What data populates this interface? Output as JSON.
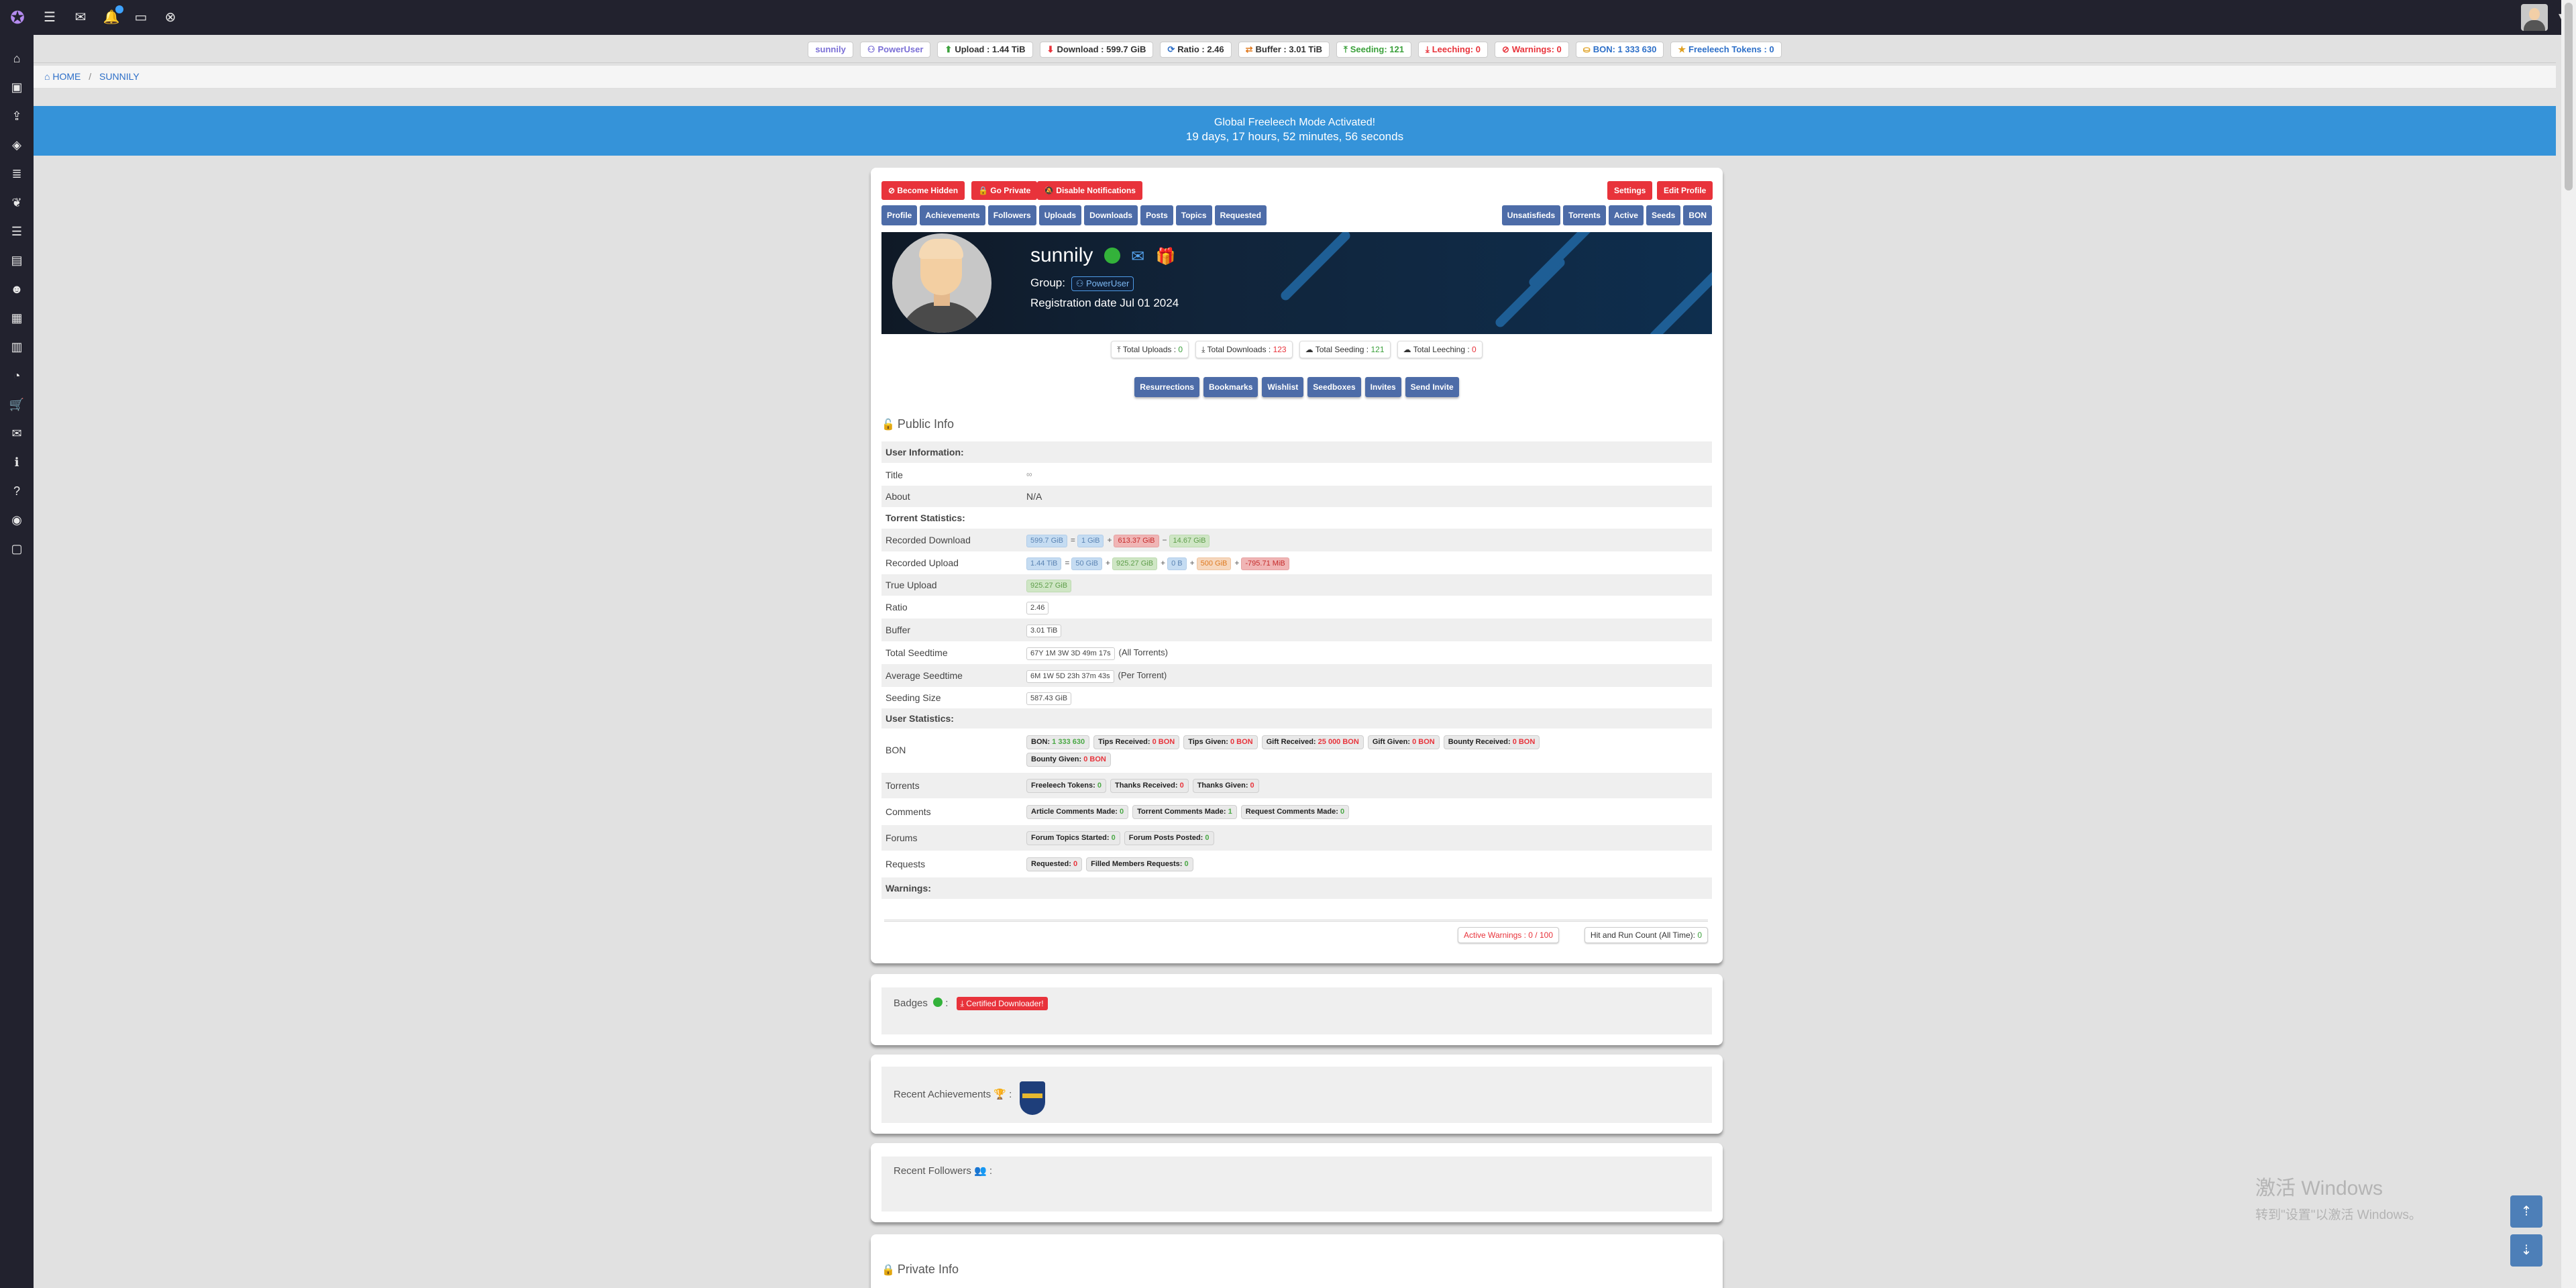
{
  "topbar": {
    "icons": [
      "menu-icon",
      "mail-icon",
      "bell-icon",
      "card-icon",
      "close-circle-icon"
    ],
    "glyphs": [
      "☰",
      "✉",
      "🔔",
      "▭",
      "⊗"
    ]
  },
  "sidebar": {
    "icons": [
      "home-icon",
      "briefcase-icon",
      "upload-icon",
      "layers-icon",
      "database-icon",
      "leaf-icon",
      "list-icon",
      "id-card-icon",
      "mask-icon",
      "images-icon",
      "chart-icon",
      "pie-chart-icon",
      "cart-icon",
      "chat-icon",
      "info-icon",
      "help-icon",
      "rss-icon",
      "comment-icon"
    ],
    "glyphs": [
      "⌂",
      "▣",
      "⇪",
      "◈",
      "≣",
      "❦",
      "☰",
      "▤",
      "☻",
      "▦",
      "▥",
      "◔",
      "🛒",
      "✉",
      "ℹ",
      "?",
      "◉",
      "▢"
    ]
  },
  "ratio_bar": {
    "username": "sunnily",
    "group": "PowerUser",
    "upload": "Upload : 1.44 TiB",
    "download": "Download : 599.7 GiB",
    "ratio": "Ratio : 2.46",
    "buffer": "Buffer : 3.01 TiB",
    "seeding": "Seeding: 121",
    "leeching": "Leeching: 0",
    "warnings": "Warnings: 0",
    "bon": "BON: 1 333 630",
    "tokens": "Freeleech Tokens : 0"
  },
  "breadcrumb": {
    "home": "HOME",
    "current": "SUNNILY"
  },
  "banner": {
    "line1": "Global Freeleech Mode Activated!",
    "line2": "19 days, 17 hours, 52 minutes, 56 seconds"
  },
  "profile_actions": {
    "become_hidden": "Become Hidden",
    "go_private": "Go Private",
    "disable_notifications": "Disable Notifications",
    "settings": "Settings",
    "edit_profile": "Edit Profile"
  },
  "profile_tabs_left": [
    "Profile",
    "Achievements",
    "Followers",
    "Uploads",
    "Downloads",
    "Posts",
    "Topics",
    "Requested"
  ],
  "profile_tabs_right": [
    "Unsatisfieds",
    "Torrents",
    "Active",
    "Seeds",
    "BON"
  ],
  "hero": {
    "username": "sunnily",
    "group_label": "Group:",
    "group": "PowerUser",
    "registration": "Registration date Jul 01 2024"
  },
  "totals": {
    "uploads_label": "Total Uploads : ",
    "uploads": "0",
    "downloads_label": "Total Downloads : ",
    "downloads": "123",
    "seeding_label": "Total Seeding : ",
    "seeding": "121",
    "leeching_label": "Total Leeching : ",
    "leeching": "0"
  },
  "extras": [
    "Resurrections",
    "Bookmarks",
    "Wishlist",
    "Seedboxes",
    "Invites",
    "Send Invite"
  ],
  "public_info": {
    "title": "Public Info",
    "user_info_header": "User Information:",
    "title_label": "Title",
    "title_value": "∞",
    "about_label": "About",
    "about_value": "N/A",
    "torrent_stats_header": "Torrent Statistics:",
    "recorded_download_label": "Recorded Download",
    "recorded_download": [
      "599.7 GiB",
      "=",
      "1 GiB",
      "+",
      "613.37 GiB",
      "−",
      "14.67 GiB"
    ],
    "recorded_upload_label": "Recorded Upload",
    "recorded_upload": [
      "1.44 TiB",
      "=",
      "50 GiB",
      "+",
      "925.27 GiB",
      "+",
      "0 B",
      "+",
      "500 GiB",
      "+",
      "-795.71 MiB"
    ],
    "true_upload_label": "True Upload",
    "true_upload": "925.27 GiB",
    "ratio_label": "Ratio",
    "ratio": "2.46",
    "buffer_label": "Buffer",
    "buffer": "3.01 TiB",
    "seedtime_label": "Total Seedtime",
    "seedtime": "67Y 1M 3W 3D 49m 17s",
    "seedtime_note": "(All Torrents)",
    "avg_seedtime_label": "Average Seedtime",
    "avg_seedtime": "6M 1W 5D 23h 37m 43s",
    "avg_seedtime_note": "(Per Torrent)",
    "seeding_size_label": "Seeding Size",
    "seeding_size": "587.43 GiB",
    "user_stats_header": "User Statistics:",
    "bon_label": "BON",
    "bon_items": [
      {
        "label": "BON: ",
        "value": "1 333 630",
        "color": "green"
      },
      {
        "label": "Tips Received: ",
        "value": "0 BON",
        "color": "red"
      },
      {
        "label": "Tips Given: ",
        "value": "0 BON",
        "color": "red"
      },
      {
        "label": "Gift Received: ",
        "value": "25 000 BON",
        "color": "red"
      },
      {
        "label": "Gift Given: ",
        "value": "0 BON",
        "color": "red"
      },
      {
        "label": "Bounty Received: ",
        "value": "0 BON",
        "color": "red"
      }
    ],
    "bon_items_2": [
      {
        "label": "Bounty Given: ",
        "value": "0 BON",
        "color": "red"
      }
    ],
    "torrents_label": "Torrents",
    "torrents_items": [
      {
        "label": "Freeleech Tokens: ",
        "value": "0",
        "color": "green"
      },
      {
        "label": "Thanks Received: ",
        "value": "0",
        "color": "red"
      },
      {
        "label": "Thanks Given: ",
        "value": "0",
        "color": "red"
      }
    ],
    "comments_label": "Comments",
    "comments_items": [
      {
        "label": "Article Comments Made: ",
        "value": "0",
        "color": "green"
      },
      {
        "label": "Torrent Comments Made: ",
        "value": "1",
        "color": "green"
      },
      {
        "label": "Request Comments Made: ",
        "value": "0",
        "color": "green"
      }
    ],
    "forums_label": "Forums",
    "forums_items": [
      {
        "label": "Forum Topics Started: ",
        "value": "0",
        "color": "green"
      },
      {
        "label": "Forum Posts Posted: ",
        "value": "0",
        "color": "green"
      }
    ],
    "requests_label": "Requests",
    "requests_items": [
      {
        "label": "Requested: ",
        "value": "0",
        "color": "red"
      },
      {
        "label": "Filled Members Requests: ",
        "value": "0",
        "color": "green"
      }
    ],
    "warnings_header": "Warnings:",
    "active_warnings": "Active Warnings : 0 / 100",
    "hit_run_label": "Hit and Run Count (All Time): ",
    "hit_run": "0"
  },
  "badges": {
    "title": "Badges",
    "badge": "Certified Downloader!"
  },
  "achievements": {
    "title": "Recent Achievements"
  },
  "followers": {
    "title": "Recent Followers"
  },
  "private_info": {
    "title": "Private Info"
  },
  "watermark": {
    "line1": "激活 Windows",
    "line2": "转到\"设置\"以激活 Windows。"
  },
  "colors": {
    "accent": "#4d6ca8",
    "danger": "#e8333b",
    "banner": "#3593d9",
    "nav": "#22222e"
  }
}
